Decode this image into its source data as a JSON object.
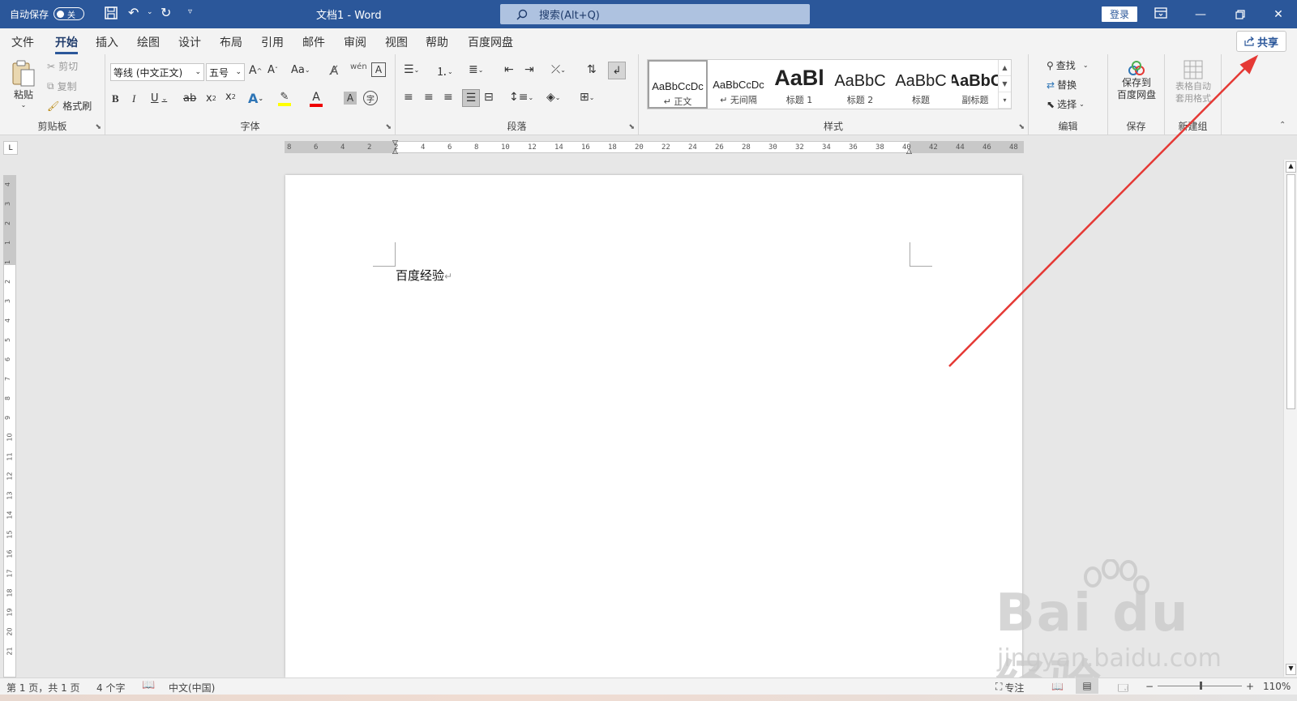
{
  "titlebar": {
    "autosave_label": "自动保存",
    "autosave_state": "关",
    "doc_title": "文档1  -  Word",
    "search_placeholder": "搜索(Alt+Q)",
    "signin_label": "登录"
  },
  "tabs": [
    "文件",
    "开始",
    "插入",
    "绘图",
    "设计",
    "布局",
    "引用",
    "邮件",
    "审阅",
    "视图",
    "帮助",
    "百度网盘"
  ],
  "active_tab": "开始",
  "share_label": "共享",
  "ribbon": {
    "clipboard": {
      "label": "剪贴板",
      "paste": "粘贴",
      "cut": "剪切",
      "copy": "复制",
      "format_painter": "格式刷"
    },
    "font": {
      "label": "字体",
      "font_name": "等线 (中文正文)",
      "font_size": "五号"
    },
    "paragraph": {
      "label": "段落"
    },
    "styles": {
      "label": "样式",
      "items": [
        {
          "preview": "AaBbCcDc",
          "name": "↵ 正文"
        },
        {
          "preview": "AaBbCcDc",
          "name": "↵ 无间隔"
        },
        {
          "preview": "AaBl",
          "name": "标题 1"
        },
        {
          "preview": "AaBbC",
          "name": "标题 2"
        },
        {
          "preview": "AaBbC",
          "name": "标题"
        },
        {
          "preview": "AaBbC",
          "name": "副标题"
        }
      ]
    },
    "editing": {
      "label": "编辑",
      "find": "查找",
      "replace": "替换",
      "select": "选择"
    },
    "save": {
      "label": "保存",
      "save_to": "保存到",
      "baidu_pan": "百度网盘"
    },
    "new_group": {
      "label": "新建组",
      "table_auto": "表格自动",
      "table_apply": "套用格式"
    }
  },
  "ruler": {
    "h_ticks": [
      "8",
      "6",
      "4",
      "2",
      "2",
      "4",
      "6",
      "8",
      "10",
      "12",
      "14",
      "16",
      "18",
      "20",
      "22",
      "24",
      "26",
      "28",
      "30",
      "32",
      "34",
      "36",
      "38",
      "40",
      "42",
      "44",
      "46",
      "48"
    ],
    "v_ticks": [
      "4",
      "3",
      "2",
      "1",
      "1",
      "2",
      "3",
      "4",
      "5",
      "6",
      "7",
      "8",
      "9",
      "10",
      "11",
      "12",
      "13",
      "14",
      "15",
      "16",
      "17",
      "18",
      "19",
      "20",
      "21"
    ]
  },
  "document": {
    "text": "百度经验",
    "paragraph_mark": "↵"
  },
  "statusbar": {
    "page_info": "第 1 页，共 1 页",
    "word_count": "4 个字",
    "language": "中文(中国)",
    "focus": "专注",
    "zoom": "110%",
    "zoom_level": 110
  },
  "watermark": {
    "brand": "Bai du经验",
    "url": "jingyan.baidu.com"
  },
  "colors": {
    "titlebar": "#2b579a",
    "annotation_arrow": "#e53935"
  }
}
